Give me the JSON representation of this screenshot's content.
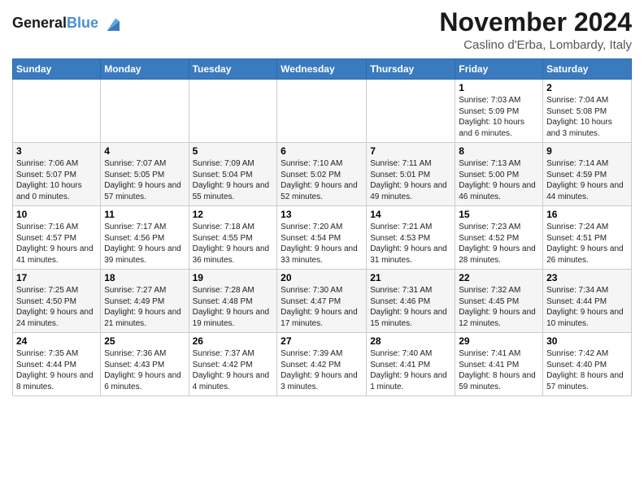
{
  "header": {
    "logo_line1": "General",
    "logo_line2": "Blue",
    "month_title": "November 2024",
    "location": "Caslino d'Erba, Lombardy, Italy"
  },
  "weekdays": [
    "Sunday",
    "Monday",
    "Tuesday",
    "Wednesday",
    "Thursday",
    "Friday",
    "Saturday"
  ],
  "weeks": [
    {
      "row_class": "row-1",
      "days": [
        {
          "date": "",
          "info": ""
        },
        {
          "date": "",
          "info": ""
        },
        {
          "date": "",
          "info": ""
        },
        {
          "date": "",
          "info": ""
        },
        {
          "date": "",
          "info": ""
        },
        {
          "date": "1",
          "info": "Sunrise: 7:03 AM\nSunset: 5:09 PM\nDaylight: 10 hours and 6 minutes."
        },
        {
          "date": "2",
          "info": "Sunrise: 7:04 AM\nSunset: 5:08 PM\nDaylight: 10 hours and 3 minutes."
        }
      ]
    },
    {
      "row_class": "row-2",
      "days": [
        {
          "date": "3",
          "info": "Sunrise: 7:06 AM\nSunset: 5:07 PM\nDaylight: 10 hours and 0 minutes."
        },
        {
          "date": "4",
          "info": "Sunrise: 7:07 AM\nSunset: 5:05 PM\nDaylight: 9 hours and 57 minutes."
        },
        {
          "date": "5",
          "info": "Sunrise: 7:09 AM\nSunset: 5:04 PM\nDaylight: 9 hours and 55 minutes."
        },
        {
          "date": "6",
          "info": "Sunrise: 7:10 AM\nSunset: 5:02 PM\nDaylight: 9 hours and 52 minutes."
        },
        {
          "date": "7",
          "info": "Sunrise: 7:11 AM\nSunset: 5:01 PM\nDaylight: 9 hours and 49 minutes."
        },
        {
          "date": "8",
          "info": "Sunrise: 7:13 AM\nSunset: 5:00 PM\nDaylight: 9 hours and 46 minutes."
        },
        {
          "date": "9",
          "info": "Sunrise: 7:14 AM\nSunset: 4:59 PM\nDaylight: 9 hours and 44 minutes."
        }
      ]
    },
    {
      "row_class": "row-3",
      "days": [
        {
          "date": "10",
          "info": "Sunrise: 7:16 AM\nSunset: 4:57 PM\nDaylight: 9 hours and 41 minutes."
        },
        {
          "date": "11",
          "info": "Sunrise: 7:17 AM\nSunset: 4:56 PM\nDaylight: 9 hours and 39 minutes."
        },
        {
          "date": "12",
          "info": "Sunrise: 7:18 AM\nSunset: 4:55 PM\nDaylight: 9 hours and 36 minutes."
        },
        {
          "date": "13",
          "info": "Sunrise: 7:20 AM\nSunset: 4:54 PM\nDaylight: 9 hours and 33 minutes."
        },
        {
          "date": "14",
          "info": "Sunrise: 7:21 AM\nSunset: 4:53 PM\nDaylight: 9 hours and 31 minutes."
        },
        {
          "date": "15",
          "info": "Sunrise: 7:23 AM\nSunset: 4:52 PM\nDaylight: 9 hours and 28 minutes."
        },
        {
          "date": "16",
          "info": "Sunrise: 7:24 AM\nSunset: 4:51 PM\nDaylight: 9 hours and 26 minutes."
        }
      ]
    },
    {
      "row_class": "row-4",
      "days": [
        {
          "date": "17",
          "info": "Sunrise: 7:25 AM\nSunset: 4:50 PM\nDaylight: 9 hours and 24 minutes."
        },
        {
          "date": "18",
          "info": "Sunrise: 7:27 AM\nSunset: 4:49 PM\nDaylight: 9 hours and 21 minutes."
        },
        {
          "date": "19",
          "info": "Sunrise: 7:28 AM\nSunset: 4:48 PM\nDaylight: 9 hours and 19 minutes."
        },
        {
          "date": "20",
          "info": "Sunrise: 7:30 AM\nSunset: 4:47 PM\nDaylight: 9 hours and 17 minutes."
        },
        {
          "date": "21",
          "info": "Sunrise: 7:31 AM\nSunset: 4:46 PM\nDaylight: 9 hours and 15 minutes."
        },
        {
          "date": "22",
          "info": "Sunrise: 7:32 AM\nSunset: 4:45 PM\nDaylight: 9 hours and 12 minutes."
        },
        {
          "date": "23",
          "info": "Sunrise: 7:34 AM\nSunset: 4:44 PM\nDaylight: 9 hours and 10 minutes."
        }
      ]
    },
    {
      "row_class": "row-5",
      "days": [
        {
          "date": "24",
          "info": "Sunrise: 7:35 AM\nSunset: 4:44 PM\nDaylight: 9 hours and 8 minutes."
        },
        {
          "date": "25",
          "info": "Sunrise: 7:36 AM\nSunset: 4:43 PM\nDaylight: 9 hours and 6 minutes."
        },
        {
          "date": "26",
          "info": "Sunrise: 7:37 AM\nSunset: 4:42 PM\nDaylight: 9 hours and 4 minutes."
        },
        {
          "date": "27",
          "info": "Sunrise: 7:39 AM\nSunset: 4:42 PM\nDaylight: 9 hours and 3 minutes."
        },
        {
          "date": "28",
          "info": "Sunrise: 7:40 AM\nSunset: 4:41 PM\nDaylight: 9 hours and 1 minute."
        },
        {
          "date": "29",
          "info": "Sunrise: 7:41 AM\nSunset: 4:41 PM\nDaylight: 8 hours and 59 minutes."
        },
        {
          "date": "30",
          "info": "Sunrise: 7:42 AM\nSunset: 4:40 PM\nDaylight: 8 hours and 57 minutes."
        }
      ]
    }
  ]
}
